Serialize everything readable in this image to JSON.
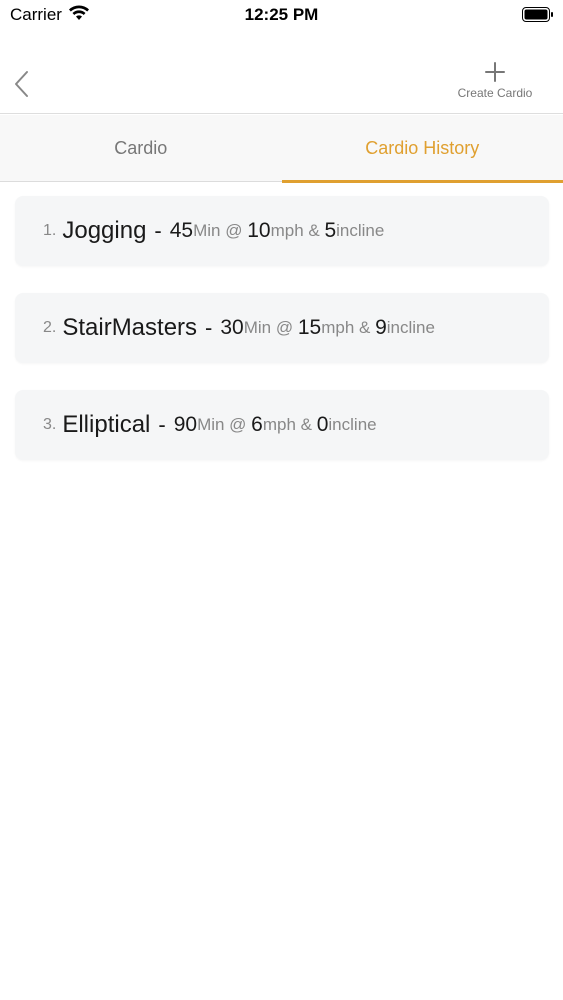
{
  "status": {
    "carrier": "Carrier",
    "time": "12:25 PM"
  },
  "nav": {
    "create_label": "Create Cardio"
  },
  "tabs": [
    {
      "label": "Cardio",
      "active": false
    },
    {
      "label": "Cardio History",
      "active": true
    }
  ],
  "history": [
    {
      "index": "1.",
      "name": "Jogging",
      "dash": "-",
      "minutes": "45",
      "min_unit": "Min @ ",
      "speed": "10",
      "speed_unit": "mph & ",
      "incline": "5",
      "incline_unit": "incline"
    },
    {
      "index": "2.",
      "name": "StairMasters",
      "dash": "-",
      "minutes": "30",
      "min_unit": "Min @ ",
      "speed": "15",
      "speed_unit": "mph & ",
      "incline": "9",
      "incline_unit": "incline"
    },
    {
      "index": "3.",
      "name": "Elliptical",
      "dash": "-",
      "minutes": "90",
      "min_unit": "Min @ ",
      "speed": "6",
      "speed_unit": "mph & ",
      "incline": "0",
      "incline_unit": "incline"
    }
  ],
  "colors": {
    "accent": "#e0a030",
    "card_bg": "#f5f6f7"
  }
}
